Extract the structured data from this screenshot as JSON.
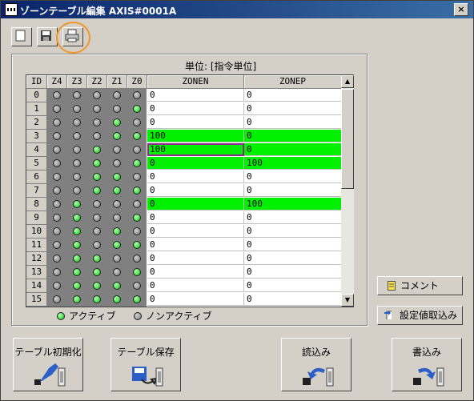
{
  "window": {
    "title": "ゾーンテーブル編集  AXIS#0001A",
    "close_glyph": "×"
  },
  "toolbar": {
    "new_icon": "blank-page-icon",
    "save_icon": "floppy-disk-icon",
    "print_icon": "printer-icon"
  },
  "table": {
    "unit_label": "単位: [指令単位]",
    "headers": {
      "id": "ID",
      "z4": "Z4",
      "z3": "Z3",
      "z2": "Z2",
      "z1": "Z1",
      "z0": "Z0",
      "zonen": "ZONEN",
      "zonep": "ZONEP"
    },
    "rows": [
      {
        "id": "0",
        "leds": [
          0,
          0,
          0,
          0,
          0
        ],
        "zonen": "0",
        "zonep": "0",
        "highlight": false
      },
      {
        "id": "1",
        "leds": [
          0,
          0,
          0,
          0,
          1
        ],
        "zonen": "0",
        "zonep": "0",
        "highlight": false
      },
      {
        "id": "2",
        "leds": [
          0,
          0,
          0,
          1,
          0
        ],
        "zonen": "0",
        "zonep": "0",
        "highlight": false
      },
      {
        "id": "3",
        "leds": [
          0,
          0,
          0,
          1,
          1
        ],
        "zonen": "100",
        "zonep": "0",
        "highlight": true
      },
      {
        "id": "4",
        "leds": [
          0,
          0,
          1,
          0,
          0
        ],
        "zonen": "100",
        "zonep": "0",
        "highlight": true,
        "selected": true
      },
      {
        "id": "5",
        "leds": [
          0,
          0,
          1,
          0,
          1
        ],
        "zonen": "0",
        "zonep": "100",
        "highlight": true
      },
      {
        "id": "6",
        "leds": [
          0,
          0,
          1,
          1,
          0
        ],
        "zonen": "0",
        "zonep": "0",
        "highlight": false
      },
      {
        "id": "7",
        "leds": [
          0,
          0,
          1,
          1,
          1
        ],
        "zonen": "0",
        "zonep": "0",
        "highlight": false
      },
      {
        "id": "8",
        "leds": [
          0,
          1,
          0,
          0,
          0
        ],
        "zonen": "0",
        "zonep": "100",
        "highlight": true
      },
      {
        "id": "9",
        "leds": [
          0,
          1,
          0,
          0,
          1
        ],
        "zonen": "0",
        "zonep": "0",
        "highlight": false
      },
      {
        "id": "10",
        "leds": [
          0,
          1,
          0,
          1,
          0
        ],
        "zonen": "0",
        "zonep": "0",
        "highlight": false
      },
      {
        "id": "11",
        "leds": [
          0,
          1,
          0,
          1,
          1
        ],
        "zonen": "0",
        "zonep": "0",
        "highlight": false
      },
      {
        "id": "12",
        "leds": [
          0,
          1,
          1,
          0,
          0
        ],
        "zonen": "0",
        "zonep": "0",
        "highlight": false
      },
      {
        "id": "13",
        "leds": [
          0,
          1,
          1,
          0,
          1
        ],
        "zonen": "0",
        "zonep": "0",
        "highlight": false
      },
      {
        "id": "14",
        "leds": [
          0,
          1,
          1,
          1,
          0
        ],
        "zonen": "0",
        "zonep": "0",
        "highlight": false
      },
      {
        "id": "15",
        "leds": [
          0,
          1,
          1,
          1,
          1
        ],
        "zonen": "0",
        "zonep": "0",
        "highlight": false
      }
    ],
    "scroll_up_glyph": "▲",
    "scroll_down_glyph": "▼"
  },
  "legend": {
    "active": "アクティブ",
    "inactive": "ノンアクティブ"
  },
  "side_buttons": {
    "comment": "コメント",
    "import_settings": "設定値取込み"
  },
  "bottom_buttons": {
    "init_table": "テーブル初期化",
    "save_table": "テーブル保存",
    "read": "読込み",
    "write": "書込み"
  },
  "colors": {
    "active_led": "#00c800",
    "highlight_row": "#00f000",
    "selection_border": "#8a2a8a",
    "title_bar": "#0a246a",
    "callout": "#f0962a"
  }
}
